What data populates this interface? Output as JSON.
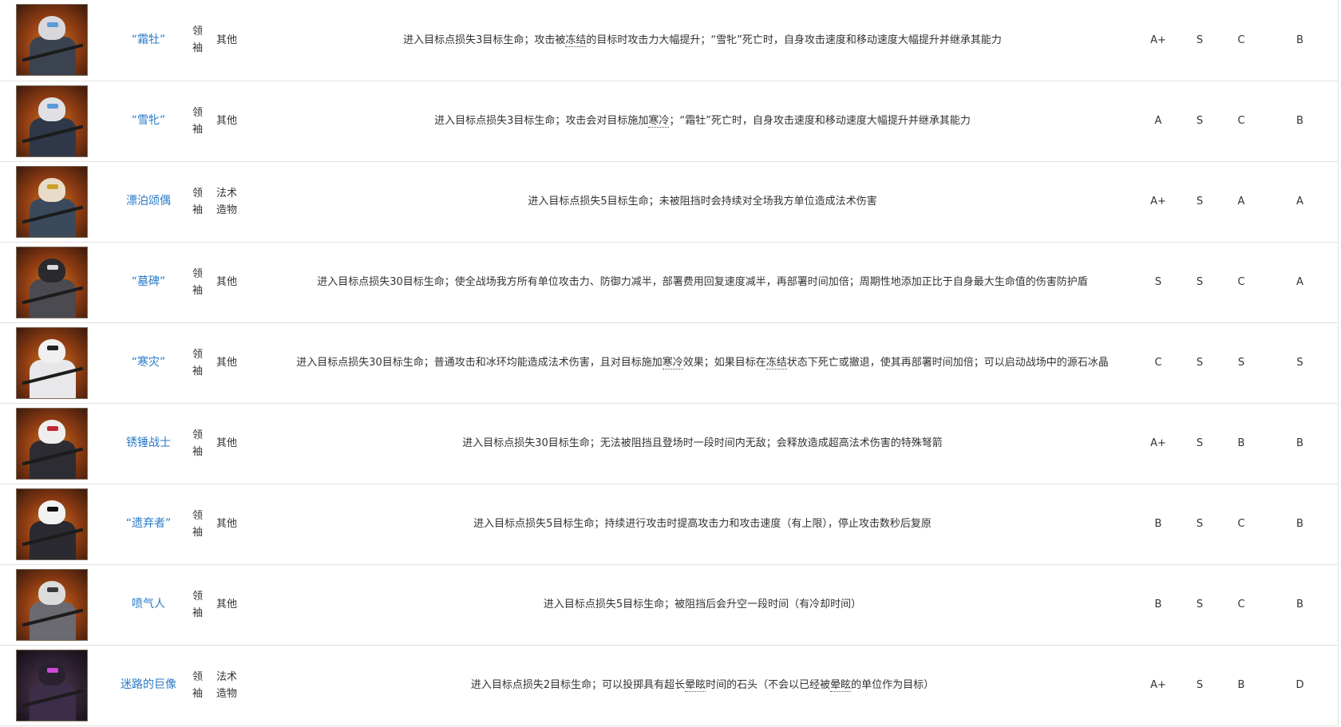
{
  "rows": [
    {
      "name": "“霜牡”",
      "level": "领袖",
      "type": "其他",
      "desc": [
        {
          "t": "进入目标点损失3目标生命；攻击被"
        },
        {
          "t": "冻结",
          "tip": true
        },
        {
          "t": "的目标时攻击力大幅提升；“雪牝”死亡时，自身攻击速度和移动速度大幅提升并继承其能力"
        }
      ],
      "ratings": [
        "A+",
        "S",
        "C",
        "B"
      ],
      "portrait": {
        "theme": "fire",
        "head": "#d8d8dc",
        "body": "#3c4350",
        "accent": "#5a9ad8"
      }
    },
    {
      "name": "“雪牝”",
      "level": "领袖",
      "type": "其他",
      "desc": [
        {
          "t": "进入目标点损失3目标生命；攻击会对目标施加"
        },
        {
          "t": "寒冷",
          "tip": true
        },
        {
          "t": "；“霜牡”死亡时，自身攻击速度和移动速度大幅提升并继承其能力"
        }
      ],
      "ratings": [
        "A",
        "S",
        "C",
        "B"
      ],
      "portrait": {
        "theme": "fire",
        "head": "#e0e0e4",
        "body": "#2f3848",
        "accent": "#5a9ad8"
      }
    },
    {
      "name": "漂泊颂偶",
      "level": "领袖",
      "type": "法术造物",
      "desc": [
        {
          "t": "进入目标点损失5目标生命；未被阻挡时会持续对全场我方单位造成法术伤害"
        }
      ],
      "ratings": [
        "A+",
        "S",
        "A",
        "A"
      ],
      "portrait": {
        "theme": "fire",
        "head": "#e8dcc8",
        "body": "#3a4a5c",
        "accent": "#c9a02a"
      }
    },
    {
      "name": "“墓碑”",
      "level": "领袖",
      "type": "其他",
      "desc": [
        {
          "t": "进入目标点损失30目标生命；使全战场我方所有单位攻击力、防御力减半，部署费用回复速度减半，再部署时间加倍；周期性地添加正比于自身最大生命值的伤害防护盾"
        }
      ],
      "ratings": [
        "S",
        "S",
        "C",
        "A"
      ],
      "portrait": {
        "theme": "fire",
        "head": "#2a2a2e",
        "body": "#4a4a50",
        "accent": "#d8d8d8"
      }
    },
    {
      "name": "“寒灾”",
      "level": "领袖",
      "type": "其他",
      "desc": [
        {
          "t": "进入目标点损失30目标生命；普通攻击和冰环均能造成法术伤害，且对目标施加"
        },
        {
          "t": "寒冷",
          "tip": true
        },
        {
          "t": "效果；如果目标在"
        },
        {
          "t": "冻结",
          "tip": true
        },
        {
          "t": "状态下死亡或撤退，使其再部署时间加倍；可以启动战场中的源石冰晶"
        }
      ],
      "ratings": [
        "C",
        "S",
        "S",
        "S"
      ],
      "portrait": {
        "theme": "fire",
        "head": "#f0f0f0",
        "body": "#e8e8ea",
        "accent": "#222222"
      }
    },
    {
      "name": "锈锤战士",
      "level": "领袖",
      "type": "其他",
      "desc": [
        {
          "t": "进入目标点损失30目标生命；无法被阻挡且登场时一段时间内无敌；会释放造成超高法术伤害的特殊弩箭"
        }
      ],
      "ratings": [
        "A+",
        "S",
        "B",
        "B"
      ],
      "portrait": {
        "theme": "fire",
        "head": "#eeeeee",
        "body": "#2c2c32",
        "accent": "#c0283a"
      }
    },
    {
      "name": "“遗弃者”",
      "level": "领袖",
      "type": "其他",
      "desc": [
        {
          "t": "进入目标点损失5目标生命；持续进行攻击时提高攻击力和攻击速度（有上限），停止攻击数秒后复原"
        }
      ],
      "ratings": [
        "B",
        "S",
        "C",
        "B"
      ],
      "portrait": {
        "theme": "fire",
        "head": "#f2f2f2",
        "body": "#2a2a30",
        "accent": "#111111"
      }
    },
    {
      "name": "喷气人",
      "level": "领袖",
      "type": "其他",
      "desc": [
        {
          "t": "进入目标点损失5目标生命；被阻挡后会升空一段时间（有冷却时间）"
        }
      ],
      "ratings": [
        "B",
        "S",
        "C",
        "B"
      ],
      "portrait": {
        "theme": "fire",
        "head": "#dcdcdc",
        "body": "#6a6a70",
        "accent": "#3a3a3a"
      }
    },
    {
      "name": "迷路的巨像",
      "level": "领袖",
      "type": "法术造物",
      "desc": [
        {
          "t": "进入目标点损失2目标生命；可以投掷具有超长"
        },
        {
          "t": "晕眩",
          "tip": true
        },
        {
          "t": "时间的石头（不会以已经被"
        },
        {
          "t": "晕眩",
          "tip": true
        },
        {
          "t": "的单位作为目标）"
        }
      ],
      "ratings": [
        "A+",
        "S",
        "B",
        "D"
      ],
      "portrait": {
        "theme": "dark",
        "head": "#2a2230",
        "body": "#3c2e48",
        "accent": "#d04ad8"
      }
    }
  ]
}
